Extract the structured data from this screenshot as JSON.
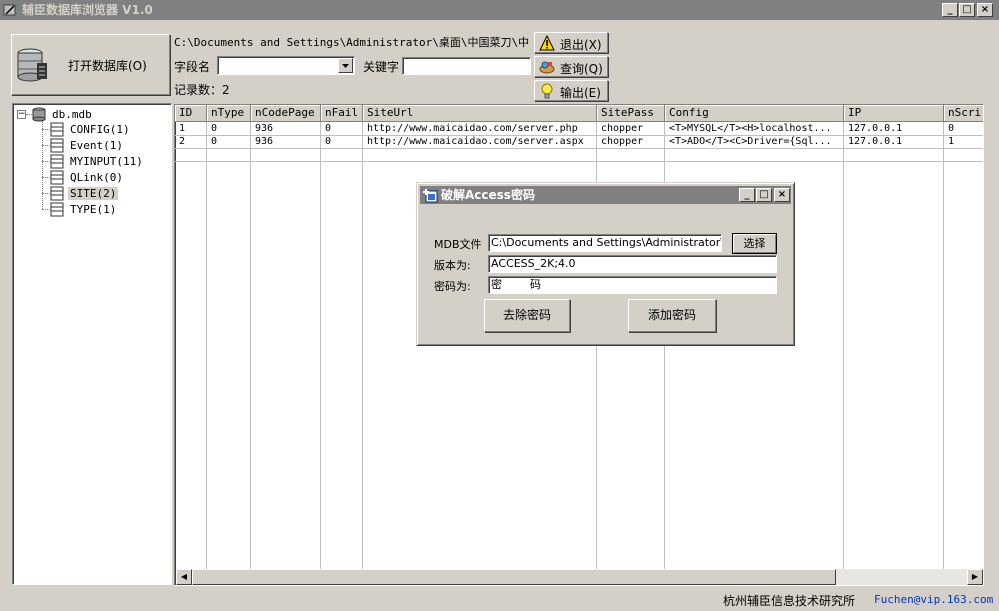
{
  "window": {
    "title": "辅臣数据库浏览器 V1.0"
  },
  "toolbar": {
    "open_db_label": "打开数据库(O)",
    "path": "C:\\Documents and Settings\\Administrator\\桌面\\中国菜刀\\中国菜",
    "field_name_label": "字段名",
    "keyword_label": "关键字",
    "field_name_value": "",
    "keyword_value": "",
    "record_count": "记录数：2",
    "exit_label": "退出(X)",
    "query_label": "查询(Q)",
    "export_label": "输出(E)"
  },
  "tree": {
    "root": "db.mdb",
    "items": [
      {
        "label": "CONFIG(1)",
        "selected": false
      },
      {
        "label": "Event(1)",
        "selected": false
      },
      {
        "label": "MYINPUT(11)",
        "selected": false
      },
      {
        "label": "QLink(0)",
        "selected": false
      },
      {
        "label": "SITE(2)",
        "selected": true
      },
      {
        "label": "TYPE(1)",
        "selected": false
      }
    ]
  },
  "grid": {
    "columns": [
      "ID",
      "nType",
      "nCodePage",
      "nFail",
      "SiteUrl",
      "SitePass",
      "Config",
      "IP",
      "nScri"
    ],
    "rows": [
      [
        "1",
        "0",
        "936",
        "0",
        "http://www.maicaidao.com/server.php",
        "chopper",
        "<T>MYSQL</T><H>localhost...",
        "127.0.0.1",
        "0"
      ],
      [
        "2",
        "0",
        "936",
        "0",
        "http://www.maicaidao.com/server.aspx",
        "chopper",
        "<T>ADO</T><C>Driver={Sql...",
        "127.0.0.1",
        "1"
      ]
    ]
  },
  "dialog": {
    "title": "破解Access密码",
    "mdb_label": "MDB文件",
    "mdb_value": "C:\\Documents and Settings\\Administrator\\桌面\\",
    "choose_label": "选择",
    "version_label": "版本为:",
    "version_value": "ACCESS_2K;4.0",
    "password_label": "密码为:",
    "password_value": "密        码",
    "remove_label": "去除密码",
    "add_label": "添加密码"
  },
  "status": {
    "company": "杭州辅臣信息技术研究所",
    "email": "Fuchen@vip.163.com"
  },
  "colors": {
    "title_inactive": "#808080",
    "face": "#d4d0c8",
    "link": "#0033cc",
    "selection": "#d4d0c8"
  }
}
